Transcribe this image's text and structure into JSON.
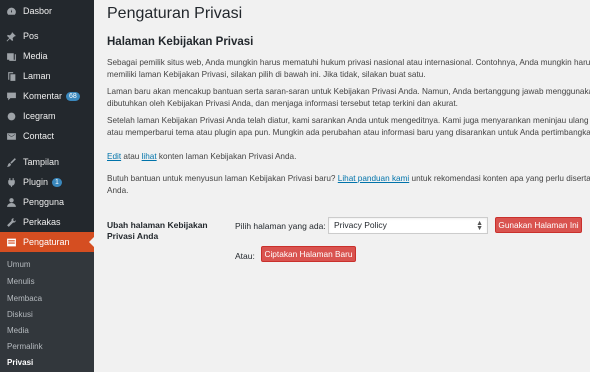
{
  "sidebar": {
    "items": [
      {
        "label": "Dasbor",
        "icon": "dashboard-icon"
      },
      {
        "label": "Pos",
        "icon": "pin-icon"
      },
      {
        "label": "Media",
        "icon": "media-icon"
      },
      {
        "label": "Laman",
        "icon": "page-icon"
      },
      {
        "label": "Komentar",
        "icon": "comment-icon",
        "badge": "68"
      },
      {
        "label": "Icegram",
        "icon": "icegram-icon"
      },
      {
        "label": "Contact",
        "icon": "mail-icon"
      },
      {
        "label": "Tampilan",
        "icon": "brush-icon"
      },
      {
        "label": "Plugin",
        "icon": "plugin-icon",
        "badge": "1"
      },
      {
        "label": "Pengguna",
        "icon": "user-icon"
      },
      {
        "label": "Perkakas",
        "icon": "wrench-icon"
      },
      {
        "label": "Pengaturan",
        "icon": "settings-icon",
        "active": true
      }
    ],
    "submenu": [
      "Umum",
      "Menulis",
      "Membaca",
      "Diskusi",
      "Media",
      "Permalink",
      "Privasi"
    ],
    "submenu_current": "Privasi"
  },
  "main": {
    "title": "Pengaturan Privasi",
    "section_title": "Halaman Kebijakan Privasi",
    "para1_line1": "Sebagai pemilik situs web, Anda mungkin harus mematuhi hukum privasi nasional atau internasional. Contohnya, Anda mungkin harus membuat dan",
    "para1_line2": "memiliki laman Kebijakan Privasi, silakan pilih di bawah ini. Jika tidak, silakan buat satu.",
    "para2_line1": "Laman baru akan mencakup bantuan serta saran-saran untuk Kebijakan Privasi Anda. Namun, Anda bertanggung jawab menggunakan sumber daya tersebut",
    "para2_line2": "dibutuhkan oleh Kebijakan Privasi Anda, dan menjaga informasi tersebut tetap terkini dan akurat.",
    "para3_line1": "Setelah laman Kebijakan Privasi Anda telah diatur, kami sarankan Anda untuk mengeditnya. Kami juga menyarankan meninjau ulang Kebijakan Privasi secara berkala,",
    "para3_line2": "atau memperbarui tema atau plugin apa pun. Mungkin ada perubahan atau informasi baru yang disarankan untuk Anda pertimbangkan di kemudian hari.",
    "edit_link": "Edit",
    "atau_1": " atau ",
    "view_link": "lihat",
    "edit_line_rest": " konten laman Kebijakan Privasi Anda.",
    "help_prefix": "Butuh bantuan untuk menyusun laman Kebijakan Privasi baru? ",
    "help_link": "Lihat panduan kami",
    "help_suffix": " untuk rekomendasi konten apa yang perlu disertakan, beserta contoh kebijakan dan",
    "help_line2": "Anda.",
    "form_label_line1": "Ubah halaman Kebijakan",
    "form_label_line2": "Privasi Anda",
    "pick_label": "Pilih halaman yang ada:",
    "select_value": "Privacy Policy",
    "use_button": "Gunakan Halaman Ini",
    "or_label": "Atau:",
    "create_button": "Ciptakan Halaman Baru"
  },
  "colors": {
    "sidebar_bg": "#23282d",
    "active_bg": "#d54e21",
    "button_red": "#d9534f",
    "link": "#0073aa"
  }
}
